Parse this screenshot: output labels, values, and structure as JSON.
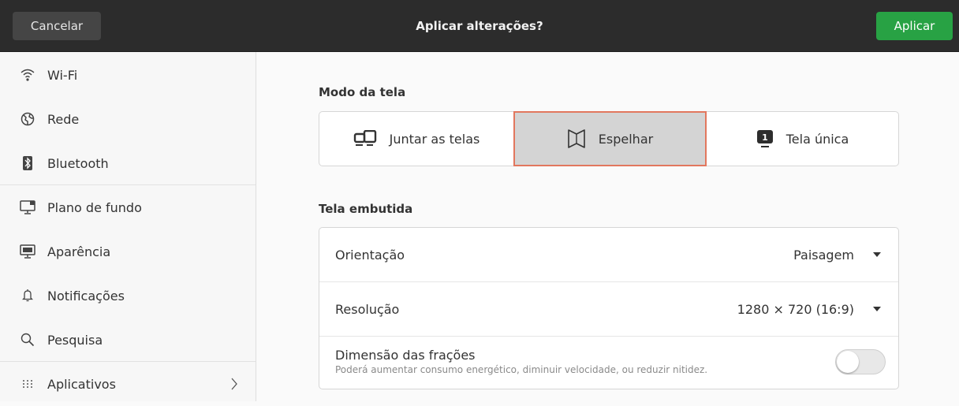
{
  "header": {
    "cancel_label": "Cancelar",
    "title": "Aplicar alterações?",
    "apply_label": "Aplicar",
    "apply_color": "#28a244"
  },
  "sidebar": {
    "items": [
      {
        "label": "Wi-Fi",
        "icon": "wifi-icon"
      },
      {
        "label": "Rede",
        "icon": "network-globe-icon"
      },
      {
        "label": "Bluetooth",
        "icon": "bluetooth-icon"
      },
      {
        "label": "Plano de fundo",
        "icon": "monitor-background-icon"
      },
      {
        "label": "Aparência",
        "icon": "appearance-icon"
      },
      {
        "label": "Notificações",
        "icon": "bell-icon"
      },
      {
        "label": "Pesquisa",
        "icon": "search-icon"
      },
      {
        "label": "Aplicativos",
        "icon": "grid-icon"
      }
    ]
  },
  "display_mode": {
    "title": "Modo da tela",
    "options": [
      {
        "label": "Juntar as telas",
        "icon": "join-displays-icon",
        "selected": false
      },
      {
        "label": "Espelhar",
        "icon": "mirror-icon",
        "selected": true
      },
      {
        "label": "Tela única",
        "icon": "single-display-icon",
        "badge": "1",
        "selected": false
      }
    ],
    "selected_border_color": "#e2775e"
  },
  "builtin": {
    "title": "Tela embutida",
    "orientation_label": "Orientação",
    "orientation_value": "Paisagem",
    "resolution_label": "Resolução",
    "resolution_value": "1280 × 720 (16:9)",
    "scaling_label": "Dimensão das frações",
    "scaling_sub": "Poderá aumentar consumo energético, diminuir velocidade, ou reduzir nitidez.",
    "scaling_enabled": false
  }
}
